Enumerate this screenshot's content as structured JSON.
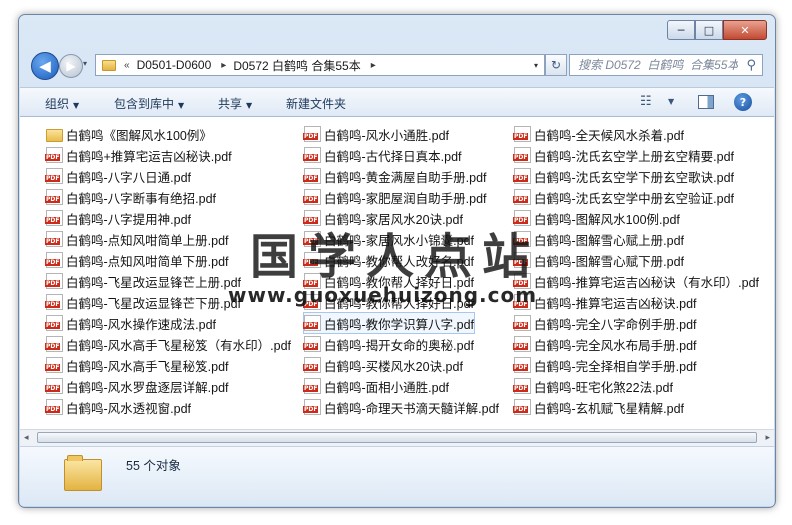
{
  "window": {
    "caption_buttons": {
      "minimize": "─",
      "maximize": "□",
      "close": "✕"
    }
  },
  "nav": {
    "back_icon": "◀",
    "forward_icon": "▶",
    "dropdown_icon": "▾",
    "address": {
      "chevron": "«",
      "separator": "▸",
      "crumbs": [
        "D0501-D0600",
        "D0572  白鹤鸣  合集55本"
      ],
      "trailing_separator": "▸",
      "dropdown_icon": "▾"
    },
    "refresh_icon": "↻",
    "search": {
      "placeholder": "搜索 D0572  白鹤鸣  合集55本",
      "icon": "⚲"
    }
  },
  "toolbar": {
    "organize": "组织",
    "include_in_library": "包含到库中",
    "share": "共享",
    "new_folder": "新建文件夹",
    "caret": "▼",
    "view_icon": "☷",
    "help": "?"
  },
  "files": {
    "col1": [
      {
        "name": "白鹤鸣《图解风水100例》",
        "type": "folder"
      },
      {
        "name": "白鹤鸣+推算宅运吉凶秘诀.pdf",
        "type": "pdf"
      },
      {
        "name": "白鹤鸣-八字八日通.pdf",
        "type": "pdf"
      },
      {
        "name": "白鹤鸣-八字断事有绝招.pdf",
        "type": "pdf"
      },
      {
        "name": "白鹤鸣-八字提用神.pdf",
        "type": "pdf"
      },
      {
        "name": "白鹤鸣-点知风咁简单上册.pdf",
        "type": "pdf"
      },
      {
        "name": "白鹤鸣-点知风咁简单下册.pdf",
        "type": "pdf"
      },
      {
        "name": "白鹤鸣-飞星改运显锋芒上册.pdf",
        "type": "pdf"
      },
      {
        "name": "白鹤鸣-飞星改运显锋芒下册.pdf",
        "type": "pdf"
      },
      {
        "name": "白鹤鸣-风水操作速成法.pdf",
        "type": "pdf"
      },
      {
        "name": "白鹤鸣-风水高手飞星秘笈（有水印）.pdf",
        "type": "pdf"
      },
      {
        "name": "白鹤鸣-风水高手飞星秘笈.pdf",
        "type": "pdf"
      },
      {
        "name": "白鹤鸣-风水罗盘逐层详解.pdf",
        "type": "pdf"
      },
      {
        "name": "白鹤鸣-风水透视窗.pdf",
        "type": "pdf"
      }
    ],
    "col2": [
      {
        "name": "白鹤鸣-风水小通胜.pdf",
        "type": "pdf"
      },
      {
        "name": "白鹤鸣-古代择日真本.pdf",
        "type": "pdf"
      },
      {
        "name": "白鹤鸣-黄金满屋自助手册.pdf",
        "type": "pdf"
      },
      {
        "name": "白鹤鸣-家肥屋润自助手册.pdf",
        "type": "pdf"
      },
      {
        "name": "白鹤鸣-家居风水20诀.pdf",
        "type": "pdf"
      },
      {
        "name": "白鹤鸣-家居风水小锦囊.pdf",
        "type": "pdf"
      },
      {
        "name": "白鹤鸣-教你帮人改好名.pdf",
        "type": "pdf"
      },
      {
        "name": "白鹤鸣-教你帮人择好日.pdf",
        "type": "pdf"
      },
      {
        "name": "白鹤鸣-教你帮人择好日.pdf",
        "type": "pdf"
      },
      {
        "name": "白鹤鸣-教你学识算八字.pdf",
        "type": "pdf",
        "selected": true
      },
      {
        "name": "白鹤鸣-揭开女命的奥秘.pdf",
        "type": "pdf"
      },
      {
        "name": "白鹤鸣-买楼风水20诀.pdf",
        "type": "pdf"
      },
      {
        "name": "白鹤鸣-面相小通胜.pdf",
        "type": "pdf"
      },
      {
        "name": "白鹤鸣-命理天书滴天髓详解.pdf",
        "type": "pdf"
      }
    ],
    "col3": [
      {
        "name": "白鹤鸣-全天候风水杀着.pdf",
        "type": "pdf"
      },
      {
        "name": "白鹤鸣-沈氏玄空学上册玄空精要.pdf",
        "type": "pdf"
      },
      {
        "name": "白鹤鸣-沈氏玄空学下册玄空歌诀.pdf",
        "type": "pdf"
      },
      {
        "name": "白鹤鸣-沈氏玄空学中册玄空验证.pdf",
        "type": "pdf"
      },
      {
        "name": "白鹤鸣-图解风水100例.pdf",
        "type": "pdf"
      },
      {
        "name": "白鹤鸣-图解雪心赋上册.pdf",
        "type": "pdf"
      },
      {
        "name": "白鹤鸣-图解雪心赋下册.pdf",
        "type": "pdf"
      },
      {
        "name": "白鹤鸣-推算宅运吉凶秘诀（有水印）.pdf",
        "type": "pdf"
      },
      {
        "name": "白鹤鸣-推算宅运吉凶秘诀.pdf",
        "type": "pdf"
      },
      {
        "name": "白鹤鸣-完全八字命例手册.pdf",
        "type": "pdf"
      },
      {
        "name": "白鹤鸣-完全风水布局手册.pdf",
        "type": "pdf"
      },
      {
        "name": "白鹤鸣-完全择相自学手册.pdf",
        "type": "pdf"
      },
      {
        "name": "白鹤鸣-旺宅化煞22法.pdf",
        "type": "pdf"
      },
      {
        "name": "白鹤鸣-玄机赋飞星精解.pdf",
        "type": "pdf"
      }
    ]
  },
  "watermark": {
    "title": "国学人点站",
    "url": "www.guoxuehuizong.com"
  },
  "scrollbar": {
    "left": "◂",
    "right": "▸"
  },
  "details": {
    "count": "55 个对象"
  }
}
